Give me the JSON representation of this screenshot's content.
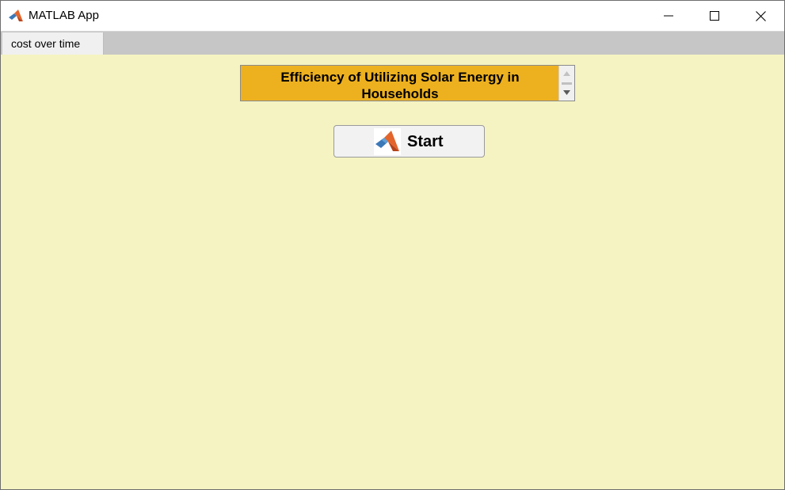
{
  "window": {
    "title": "MATLAB App",
    "icon": "matlab-logo-icon",
    "controls": [
      "minimize-icon",
      "maximize-icon",
      "close-icon"
    ]
  },
  "tabs": [
    {
      "label": "cost over time",
      "selected": true
    }
  ],
  "main": {
    "textarea": {
      "value": "Efficiency of Utilizing Solar Energy in Households",
      "background_color": "#edb120"
    },
    "start_button": {
      "label": "Start",
      "icon": "matlab-logo-icon"
    },
    "background_color": "#f5f3c1"
  }
}
